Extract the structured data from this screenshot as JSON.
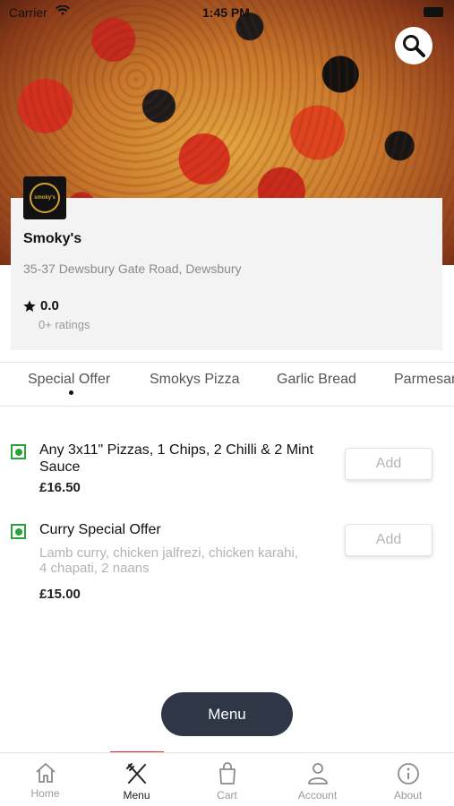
{
  "status_bar": {
    "carrier": "Carrier",
    "time": "1:45 PM"
  },
  "store": {
    "name": "Smoky's",
    "logo_text": "smoky's",
    "address": "35-37 Dewsbury Gate Road, Dewsbury",
    "rating": "0.0",
    "ratings_count": "0+ ratings"
  },
  "tabs": [
    {
      "label": "Special Offer",
      "active": true
    },
    {
      "label": "Smokys Pizza",
      "active": false
    },
    {
      "label": "Garlic Bread",
      "active": false
    },
    {
      "label": "Parmesan",
      "active": false
    }
  ],
  "menu_items": [
    {
      "title": "Any 3x11\" Pizzas, 1 Chips, 2 Chilli & 2 Mint Sauce",
      "description": "",
      "price": "£16.50",
      "add_label": "Add"
    },
    {
      "title": "Curry Special Offer",
      "description": "Lamb curry, chicken jalfrezi, chicken karahi, 4 chapati, 2 naans",
      "price": "£15.00",
      "add_label": "Add"
    }
  ],
  "menu_button": {
    "label": "Menu"
  },
  "bottom_nav": [
    {
      "label": "Home",
      "icon": "home-icon",
      "active": false
    },
    {
      "label": "Menu",
      "icon": "fork-knife-icon",
      "active": true
    },
    {
      "label": "Cart",
      "icon": "bag-icon",
      "active": false
    },
    {
      "label": "Account",
      "icon": "user-icon",
      "active": false
    },
    {
      "label": "About",
      "icon": "info-icon",
      "active": false
    }
  ],
  "colors": {
    "accent": "#e02a2a",
    "fab": "#2f3747",
    "veg": "#2aa43a"
  }
}
